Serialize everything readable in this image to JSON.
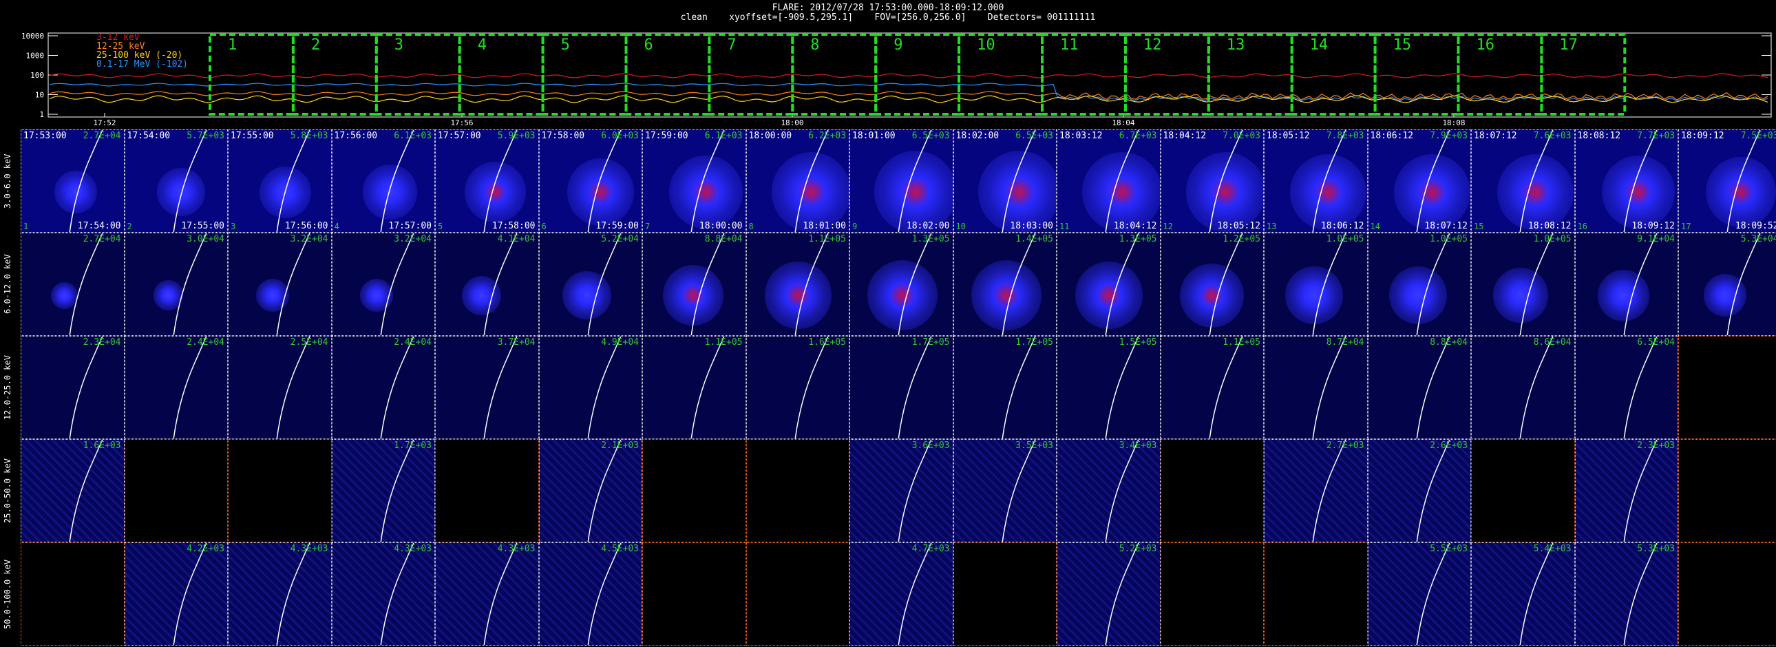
{
  "header": {
    "title": "FLARE: 2012/07/28 17:53:00.000-18:09:12.000",
    "subtitle": "clean    xyoffset=[-909.5,295.1]    FOV=[256.0,256.0]    Detectors= 001111111"
  },
  "lightcurve": {
    "yticks": [
      "10000",
      "1000",
      "100",
      "10",
      "1"
    ],
    "xticks": [
      "17:52",
      "17:56",
      "18:00",
      "18:04",
      "18:08"
    ],
    "legend": [
      {
        "label": "3-12 keV",
        "color": "#d81b1b"
      },
      {
        "label": "12-25 keV",
        "color": "#ff7f1a"
      },
      {
        "label": "25-100 keV (-20)",
        "color": "#ffd21a"
      },
      {
        "label": "0.1-17 MeV (-102)",
        "color": "#2f8fff"
      }
    ],
    "intervals": [
      "1",
      "2",
      "3",
      "4",
      "5",
      "6",
      "7",
      "8",
      "9",
      "10",
      "11",
      "12",
      "13",
      "14",
      "15",
      "16",
      "17"
    ],
    "interval_color": "#22dd22"
  },
  "bands": [
    "3.0-6.0 keV",
    "6.0-12.0 keV",
    "12.0-25.0 keV",
    "25.0-50.0 keV",
    "50.0-100.0 keV"
  ],
  "times_start": [
    "17:53:00",
    "17:54:00",
    "17:55:00",
    "17:56:00",
    "17:57:00",
    "17:58:00",
    "17:59:00",
    "18:00:00",
    "18:01:00",
    "18:02:00",
    "18:03:12",
    "18:04:12",
    "18:05:12",
    "18:06:12",
    "18:07:12",
    "18:08:12",
    "18:09:12"
  ],
  "times_end": [
    "17:54:00",
    "17:55:00",
    "17:56:00",
    "17:57:00",
    "17:58:00",
    "17:59:00",
    "18:00:00",
    "18:01:00",
    "18:02:00",
    "18:03:00",
    "18:04:12",
    "18:05:12",
    "18:06:12",
    "18:07:12",
    "18:08:12",
    "18:09:12",
    "18:09:52"
  ],
  "rows": [
    {
      "flux": [
        "2.7E+04",
        "5.7E+03",
        "5.8E+03",
        "6.1E+03",
        "5.9E+03",
        "6.0E+03",
        "6.1E+03",
        "6.2E+03",
        "6.5E+03",
        "6.5E+03",
        "6.7E+03",
        "7.0E+03",
        "7.8E+03",
        "7.9E+03",
        "7.6E+03",
        "7.7E+03",
        "7.5E+03"
      ],
      "blank": [
        false,
        false,
        false,
        false,
        false,
        false,
        false,
        false,
        false,
        false,
        false,
        false,
        false,
        false,
        false,
        false,
        false
      ],
      "intensity": [
        0.35,
        0.45,
        0.5,
        0.55,
        0.65,
        0.75,
        0.85,
        0.95,
        1.0,
        1.0,
        0.95,
        0.95,
        0.9,
        0.9,
        0.9,
        0.85,
        0.8
      ]
    },
    {
      "flux": [
        "2.7E+04",
        "3.0E+04",
        "3.2E+04",
        "3.2E+04",
        "4.1E+04",
        "5.2E+04",
        "8.8E+04",
        "1.1E+05",
        "1.3E+05",
        "1.4E+05",
        "1.3E+05",
        "1.2E+05",
        "1.0E+05",
        "1.0E+05",
        "1.0E+05",
        "9.1E+04",
        "5.3E+04"
      ],
      "blank": [
        false,
        false,
        false,
        false,
        false,
        false,
        false,
        false,
        false,
        false,
        false,
        false,
        false,
        false,
        false,
        false,
        false
      ],
      "intensity": [
        0.1,
        0.15,
        0.2,
        0.2,
        0.3,
        0.45,
        0.65,
        0.75,
        0.8,
        0.8,
        0.75,
        0.7,
        0.6,
        0.6,
        0.55,
        0.5,
        0.35
      ]
    },
    {
      "flux": [
        "2.3E+04",
        "2.4E+04",
        "2.5E+04",
        "2.4E+04",
        "3.7E+04",
        "4.9E+04",
        "1.1E+05",
        "1.6E+05",
        "1.7E+05",
        "1.7E+05",
        "1.5E+05",
        "1.1E+05",
        "8.7E+04",
        "8.8E+04",
        "8.6E+04",
        "6.5E+04",
        ""
      ],
      "blank": [
        false,
        false,
        false,
        false,
        false,
        false,
        false,
        false,
        false,
        false,
        false,
        false,
        false,
        false,
        false,
        false,
        true
      ],
      "intensity": [
        0,
        0,
        0,
        0,
        0,
        0,
        0,
        0,
        0,
        0,
        0,
        0,
        0,
        0,
        0,
        0,
        0
      ]
    },
    {
      "flux": [
        "1.6E+03",
        "",
        "",
        "1.7E+03",
        "",
        "2.1E+03",
        "",
        "",
        "3.6E+03",
        "3.5E+03",
        "3.4E+03",
        "",
        "2.7E+03",
        "2.6E+03",
        "",
        "2.3E+03",
        ""
      ],
      "blank": [
        false,
        true,
        true,
        false,
        true,
        false,
        true,
        true,
        false,
        false,
        false,
        true,
        false,
        false,
        true,
        false,
        true
      ],
      "intensity": [
        0,
        0,
        0,
        0,
        0,
        0,
        0,
        0,
        0,
        0,
        0,
        0,
        0,
        0,
        0,
        0,
        0
      ]
    },
    {
      "flux": [
        "",
        "4.2E+03",
        "4.3E+03",
        "4.3E+03",
        "4.3E+03",
        "4.5E+03",
        "",
        "",
        "4.7E+03",
        "",
        "5.2E+03",
        "",
        "",
        "5.5E+03",
        "5.4E+03",
        "5.3E+03",
        ""
      ],
      "blank": [
        true,
        false,
        false,
        false,
        false,
        false,
        true,
        true,
        false,
        true,
        false,
        true,
        true,
        false,
        false,
        false,
        true
      ],
      "intensity": [
        0,
        0,
        0,
        0,
        0,
        0,
        0,
        0,
        0,
        0,
        0,
        0,
        0,
        0,
        0,
        0,
        0
      ]
    }
  ]
}
